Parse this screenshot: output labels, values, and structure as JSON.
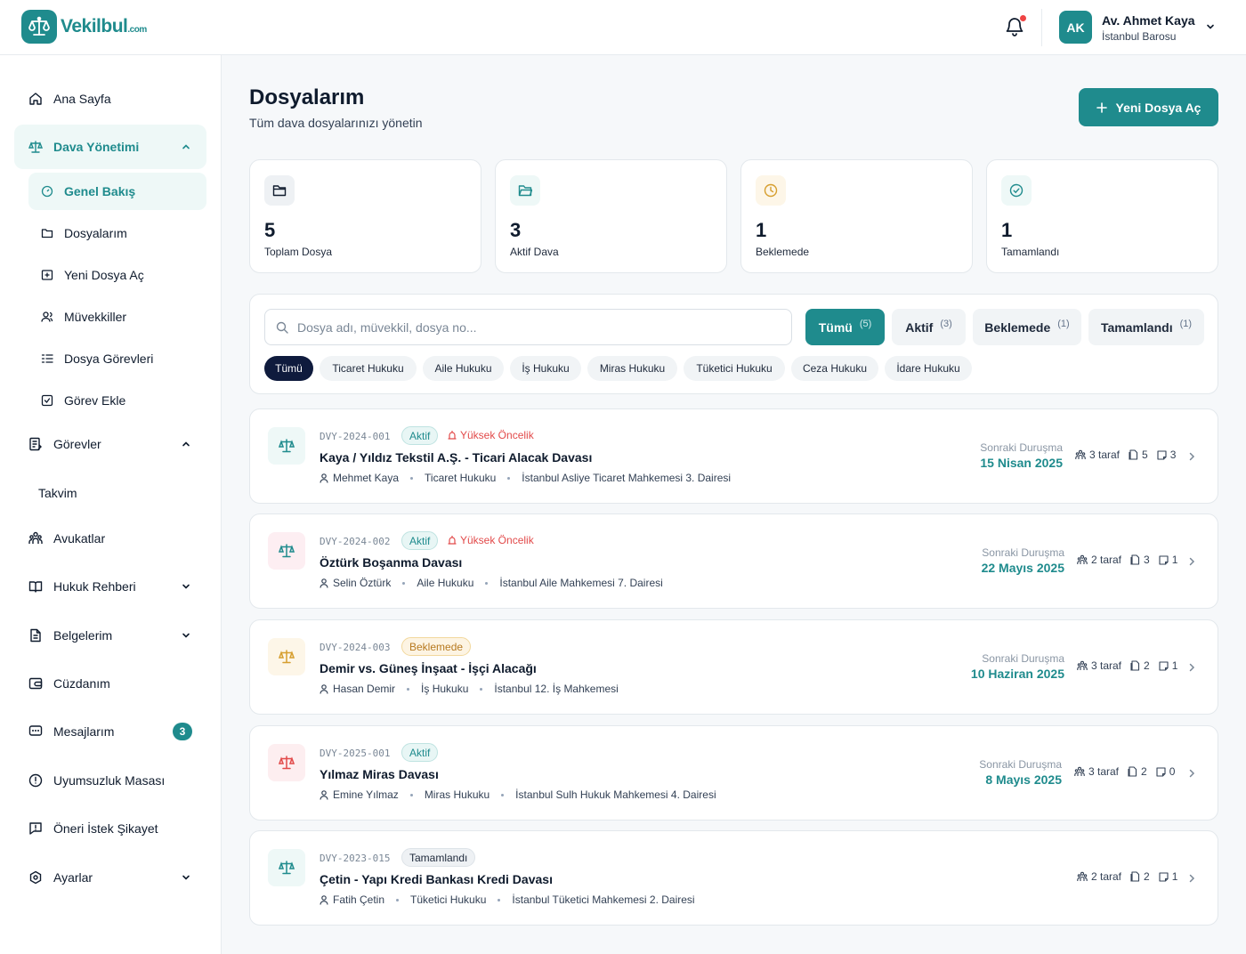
{
  "brand": {
    "name": "Vekilbul",
    "suffix": ".com",
    "color": "#1f8b8d"
  },
  "user": {
    "initials": "AK",
    "name": "Av. Ahmet Kaya",
    "org": "İstanbul Barosu"
  },
  "sidebar": {
    "items": [
      {
        "label": "Ana Sayfa",
        "icon": "home-icon"
      },
      {
        "label": "Dava Yönetimi",
        "icon": "scale-icon",
        "expanded": true
      },
      {
        "label": "Görevler",
        "icon": "task-icon",
        "expanded": true
      },
      {
        "label": "Takvim"
      },
      {
        "label": "Avukatlar",
        "icon": "people-icon"
      },
      {
        "label": "Hukuk Rehberi",
        "icon": "book-icon"
      },
      {
        "label": "Belgelerim",
        "icon": "document-icon"
      },
      {
        "label": "Cüzdanım",
        "icon": "wallet-icon"
      },
      {
        "label": "Mesajlarım",
        "icon": "message-icon",
        "badge": "3"
      },
      {
        "label": "Uyumsuzluk Masası",
        "icon": "alert-icon"
      },
      {
        "label": "Öneri İstek Şikayet",
        "icon": "feedback-icon"
      },
      {
        "label": "Ayarlar",
        "icon": "settings-icon"
      }
    ],
    "sub_items": [
      {
        "label": "Genel Bakış",
        "icon": "gauge-icon"
      },
      {
        "label": "Dosyalarım",
        "icon": "folder-icon"
      },
      {
        "label": "Yeni Dosya Aç",
        "icon": "folder-plus-icon"
      },
      {
        "label": "Müvekkiller",
        "icon": "users-icon"
      },
      {
        "label": "Dosya Görevleri",
        "icon": "list-icon"
      },
      {
        "label": "Görev Ekle",
        "icon": "checkbox-icon"
      }
    ]
  },
  "page": {
    "title": "Dosyalarım",
    "subtitle": "Tüm dava dosyalarınızı yönetin",
    "new_button": "Yeni Dosya Aç"
  },
  "stats": [
    {
      "value": "5",
      "label": "Toplam Dosya",
      "icon": "folder-icon",
      "color": "#0f1b2d"
    },
    {
      "value": "3",
      "label": "Aktif Dava",
      "icon": "folder-open-icon",
      "color": "#1f8b8d"
    },
    {
      "value": "1",
      "label": "Beklemede",
      "icon": "clock-icon",
      "color": "#d69e2e"
    },
    {
      "value": "1",
      "label": "Tamamlandı",
      "icon": "check-circle-icon",
      "color": "#1f8b8d"
    }
  ],
  "search": {
    "placeholder": "Dosya adı, müvekkil, dosya no..."
  },
  "tabs": [
    {
      "label": "Tümü",
      "count": "(5)"
    },
    {
      "label": "Aktif",
      "count": "(3)"
    },
    {
      "label": "Beklemede",
      "count": "(1)"
    },
    {
      "label": "Tamamlandı",
      "count": "(1)"
    }
  ],
  "chips": [
    "Tümü",
    "Ticaret Hukuku",
    "Aile Hukuku",
    "İş Hukuku",
    "Miras Hukuku",
    "Tüketici Hukuku",
    "Ceza Hukuku",
    "İdare Hukuku"
  ],
  "next_label": "Sonraki Duruşma",
  "priority_label": "Yüksek Öncelik",
  "cases": [
    {
      "no": "DVY-2024-001",
      "status": "Aktif",
      "priority": true,
      "title": "Kaya / Yıldız Tekstil A.Ş. - Ticari Alacak Davası",
      "client": "Mehmet Kaya",
      "area": "Ticaret Hukuku",
      "court": "İstanbul Asliye Ticaret Mahkemesi 3. Dairesi",
      "next": "15 Nisan 2025",
      "parties": "3 taraf",
      "docs": "5",
      "notes": "3",
      "icon_color": "#1f8b8d",
      "icon_bg": "#eef8f7"
    },
    {
      "no": "DVY-2024-002",
      "status": "Aktif",
      "priority": true,
      "title": "Öztürk Boşanma Davası",
      "client": "Selin Öztürk",
      "area": "Aile Hukuku",
      "court": "İstanbul Aile Mahkemesi 7. Dairesi",
      "next": "22 Mayıs 2025",
      "parties": "2 taraf",
      "docs": "3",
      "notes": "1",
      "icon_color": "#1f8b8d",
      "icon_bg": "#fdeef2"
    },
    {
      "no": "DVY-2024-003",
      "status": "Beklemede",
      "priority": false,
      "title": "Demir vs. Güneş İnşaat - İşçi Alacağı",
      "client": "Hasan Demir",
      "area": "İş Hukuku",
      "court": "İstanbul 12. İş Mahkemesi",
      "next": "10 Haziran 2025",
      "parties": "3 taraf",
      "docs": "2",
      "notes": "1",
      "icon_color": "#d69e2e",
      "icon_bg": "#fdf6e8"
    },
    {
      "no": "DVY-2025-001",
      "status": "Aktif",
      "priority": false,
      "title": "Yılmaz Miras Davası",
      "client": "Emine Yılmaz",
      "area": "Miras Hukuku",
      "court": "İstanbul Sulh Hukuk Mahkemesi 4. Dairesi",
      "next": "8 Mayıs 2025",
      "parties": "3 taraf",
      "docs": "2",
      "notes": "0",
      "icon_color": "#e24a4a",
      "icon_bg": "#fdeef0"
    },
    {
      "no": "DVY-2023-015",
      "status": "Tamamlandı",
      "priority": false,
      "title": "Çetin - Yapı Kredi Bankası Kredi Davası",
      "client": "Fatih Çetin",
      "area": "Tüketici Hukuku",
      "court": "İstanbul Tüketici Mahkemesi 2. Dairesi",
      "next": "",
      "parties": "2 taraf",
      "docs": "2",
      "notes": "1",
      "icon_color": "#1f8b8d",
      "icon_bg": "#eef8f7"
    }
  ]
}
